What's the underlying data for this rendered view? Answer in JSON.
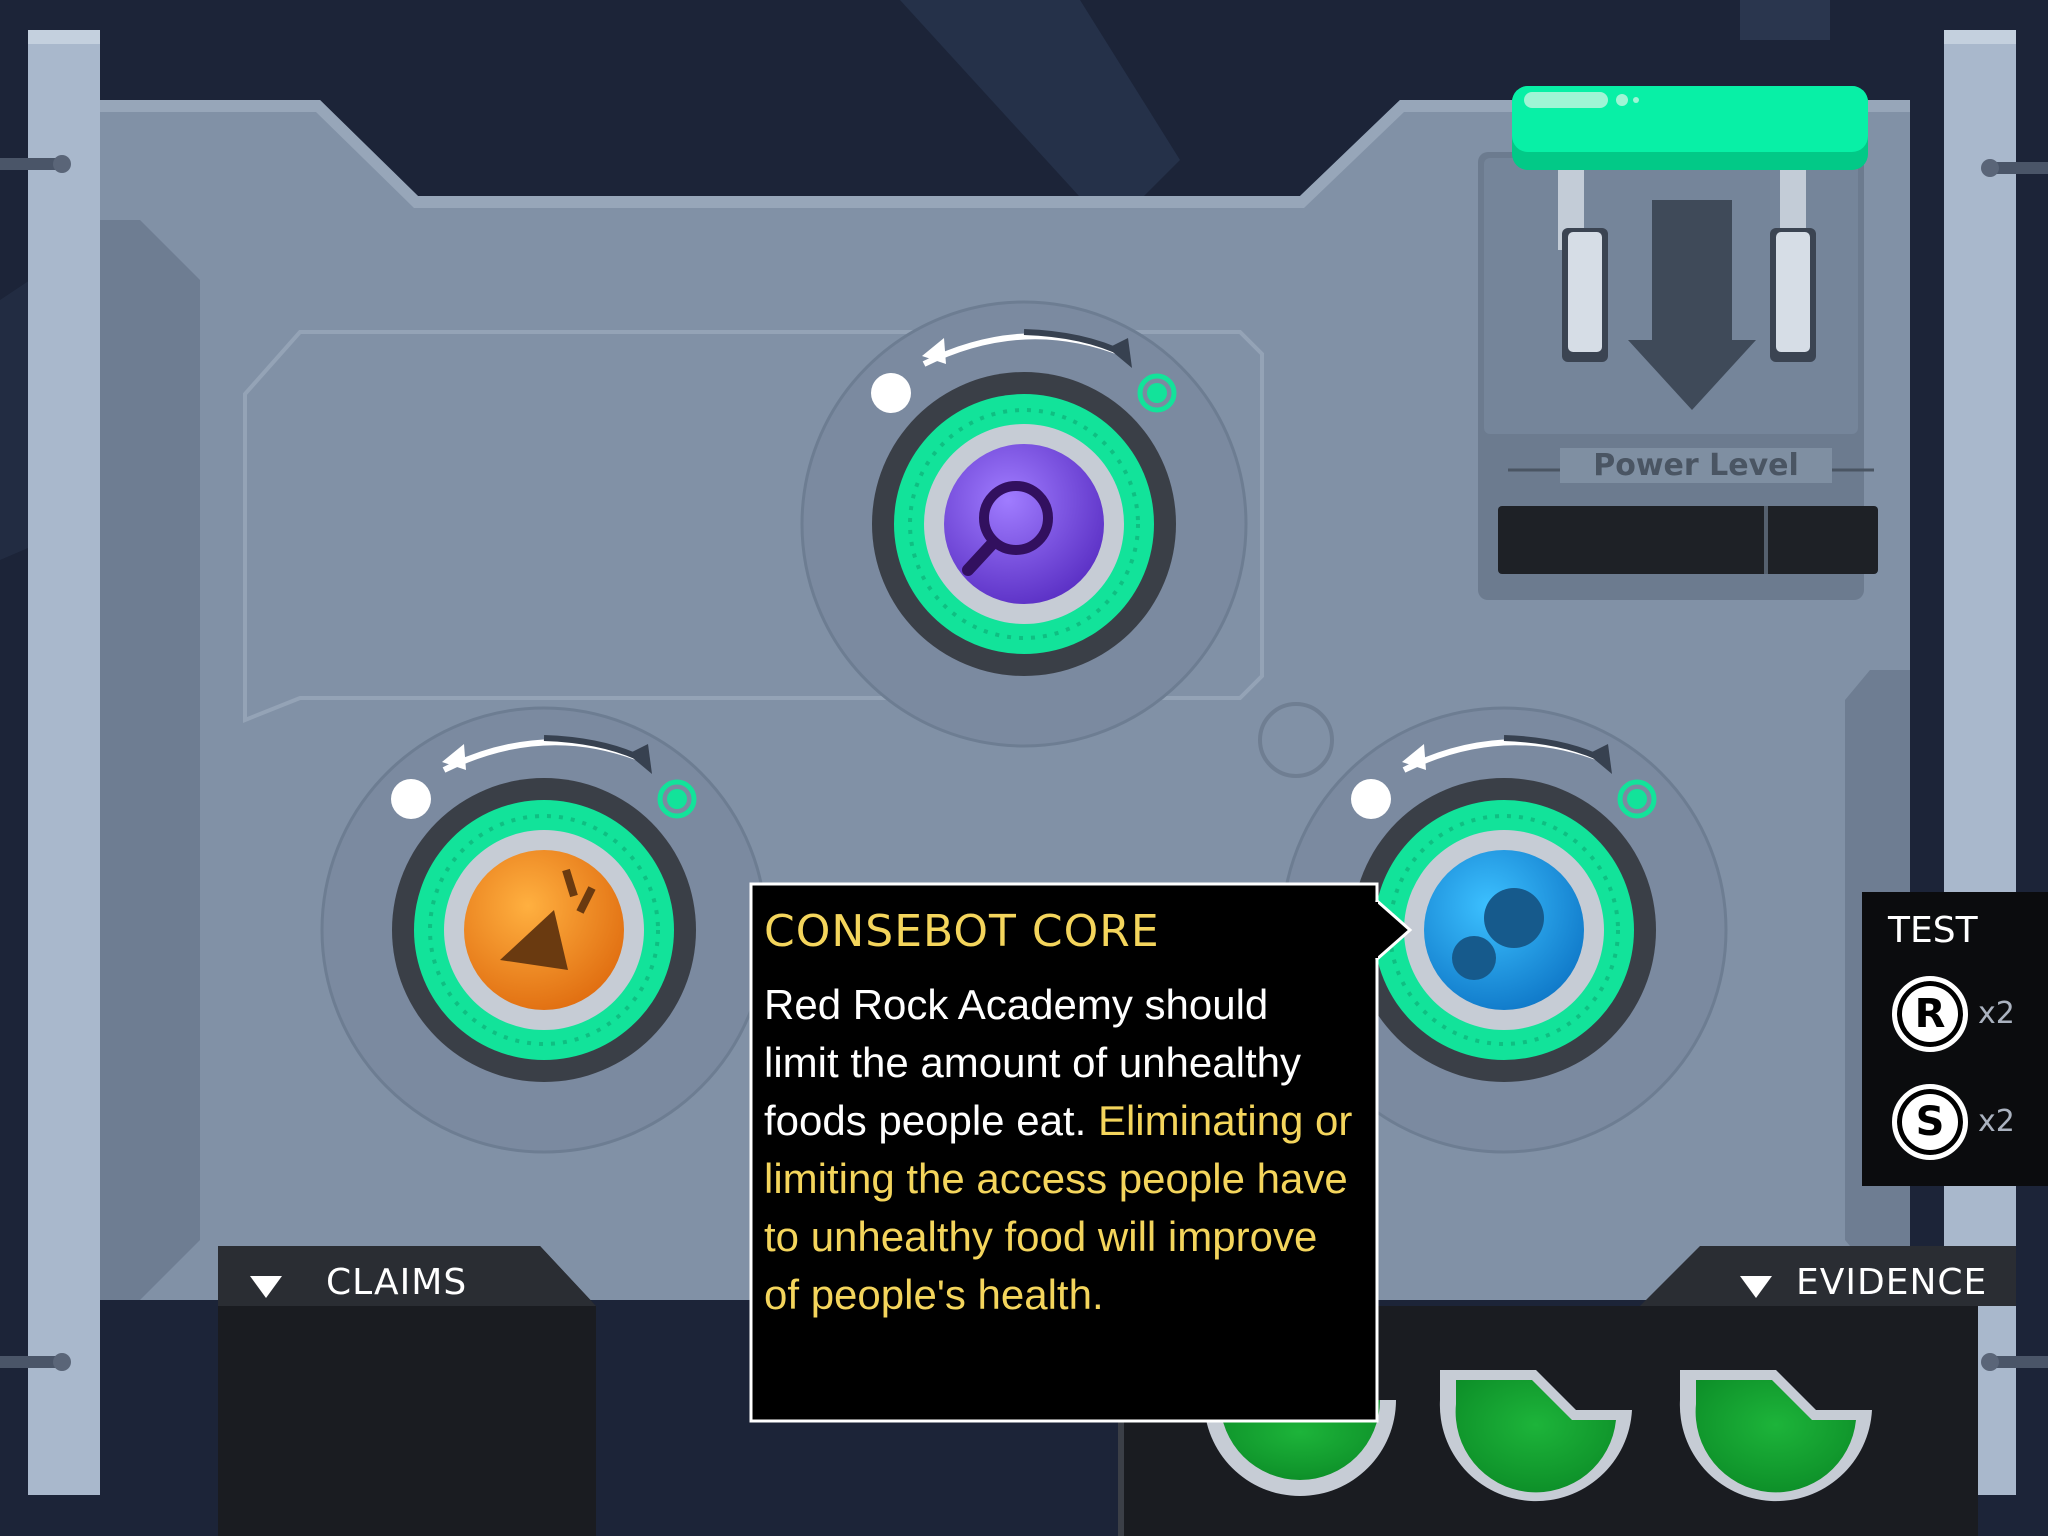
{
  "tooltip": {
    "title": "CONSEBOT CORE",
    "claim": "Red Rock Academy should limit the amount of unhealthy foods people eat.",
    "reason": "Eliminating or limiting the access people have to unhealthy food will improve of people's health."
  },
  "power_panel": {
    "label": "Power Level"
  },
  "claims_tab": {
    "label": "CLAIMS"
  },
  "evidence_tab": {
    "label": "EVIDENCE"
  },
  "test_panel": {
    "title": "TEST",
    "items": [
      {
        "badge": "R",
        "count": "x2"
      },
      {
        "badge": "S",
        "count": "x2"
      }
    ]
  },
  "dials": [
    {
      "icon": "magnifier-icon",
      "color": "#7b4fe0"
    },
    {
      "icon": "megaphone-icon",
      "color": "#f08a1a"
    },
    {
      "icon": "gears-icon",
      "color": "#1d9ae0"
    }
  ],
  "colors": {
    "accent_green": "#12e39a",
    "tooltip_title": "#f4d55c",
    "panel_gray": "#7f8fa2"
  }
}
